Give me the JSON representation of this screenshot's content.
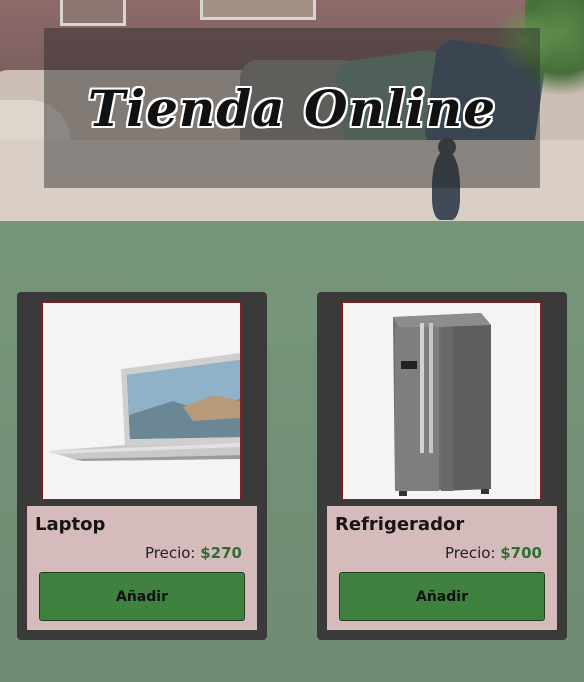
{
  "header": {
    "title": "Tienda Online"
  },
  "products": [
    {
      "name": "Laptop",
      "price_label": "Precio:",
      "price_value": "$270",
      "button_label": "Añadir",
      "icon": "laptop-image"
    },
    {
      "name": "Refrigerador",
      "price_label": "Precio:",
      "price_value": "$700",
      "button_label": "Añadir",
      "icon": "refrigerator-image"
    }
  ],
  "colors": {
    "button": "#3f813f",
    "price": "#2f6e33",
    "card_info": "#d5bbbb",
    "card_frame": "#3a3a3a"
  }
}
